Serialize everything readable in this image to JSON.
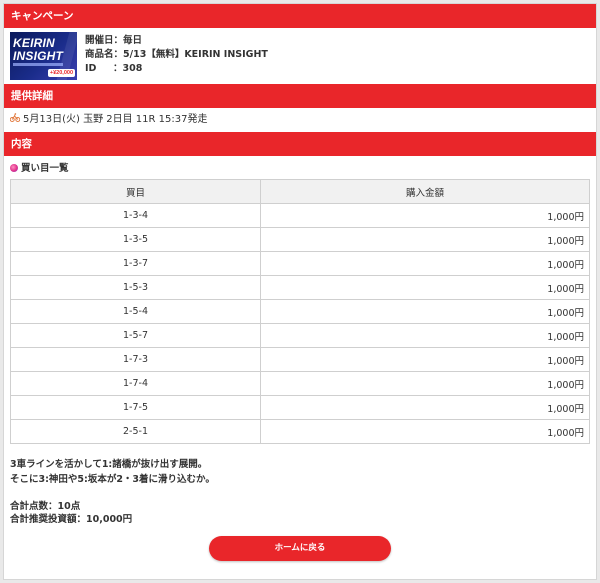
{
  "campaign": {
    "header": "キャンペーン",
    "thumbnail": {
      "line1": "KEIRIN",
      "line2": "INSIGHT",
      "badge": "+¥20,000"
    },
    "date_label": "開催日：",
    "date_value": "毎日",
    "product_label": "商品名：",
    "product_value": "5/13【無料】KEIRIN INSIGHT",
    "id_label": "ID",
    "id_value": "：308"
  },
  "detail": {
    "header": "提供詳細",
    "race_icon": "bicycle-icon",
    "race_text": "5月13日(火) 玉野 2日目 11R 15:37発走"
  },
  "content": {
    "header": "内容",
    "list_title_icon": "target-icon",
    "list_title": "買い目一覧",
    "columns": [
      "買目",
      "購入金額"
    ],
    "rows": [
      {
        "combo": "1-3-4",
        "amount": "1,000円"
      },
      {
        "combo": "1-3-5",
        "amount": "1,000円"
      },
      {
        "combo": "1-3-7",
        "amount": "1,000円"
      },
      {
        "combo": "1-5-3",
        "amount": "1,000円"
      },
      {
        "combo": "1-5-4",
        "amount": "1,000円"
      },
      {
        "combo": "1-5-7",
        "amount": "1,000円"
      },
      {
        "combo": "1-7-3",
        "amount": "1,000円"
      },
      {
        "combo": "1-7-4",
        "amount": "1,000円"
      },
      {
        "combo": "1-7-5",
        "amount": "1,000円"
      },
      {
        "combo": "2-5-1",
        "amount": "1,000円"
      }
    ],
    "comment": "3車ラインを活かして1:諸橋が抜け出す展開。\nそこに3:神田や5:坂本が2・3着に滑り込むか。",
    "total_points": "合計点数：10点",
    "total_amount": "合計推奨投資額：10,000円"
  },
  "home_button": "ホームに戻る",
  "colors": {
    "accent": "#e9262a"
  }
}
